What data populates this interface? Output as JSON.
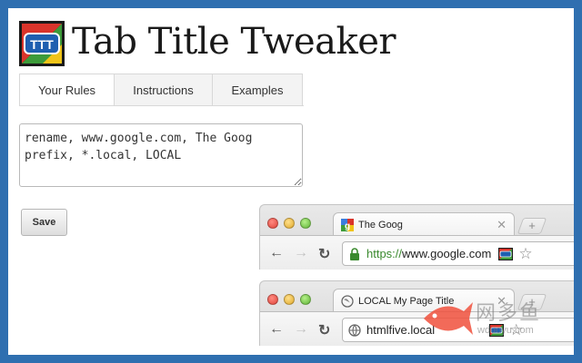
{
  "header": {
    "title": "Tab Title Tweaker",
    "logo_text": "TTT"
  },
  "tabs": [
    {
      "label": "Your Rules",
      "active": true
    },
    {
      "label": "Instructions",
      "active": false
    },
    {
      "label": "Examples",
      "active": false
    }
  ],
  "rules": {
    "value": "rename, www.google.com, The Goog\nprefix, *.local, LOCAL"
  },
  "save_label": "Save",
  "browsers": [
    {
      "tab_title": "The Goog",
      "url_scheme": "https://",
      "url_host": "www.google.com",
      "secure": true
    },
    {
      "tab_title": "LOCAL My Page Title",
      "url_scheme": "",
      "url_host": "htmlfive.local",
      "secure": false
    }
  ],
  "watermark": {
    "cn": "网多鱼",
    "en": "wduoyu.com"
  },
  "colors": {
    "background": "#2f6fb0",
    "https_green": "#3a8a2e",
    "logo_blue": "#1f5fb0",
    "logo_green": "#3d9b3a",
    "logo_yellow": "#f0c419",
    "logo_red": "#d9342b"
  }
}
